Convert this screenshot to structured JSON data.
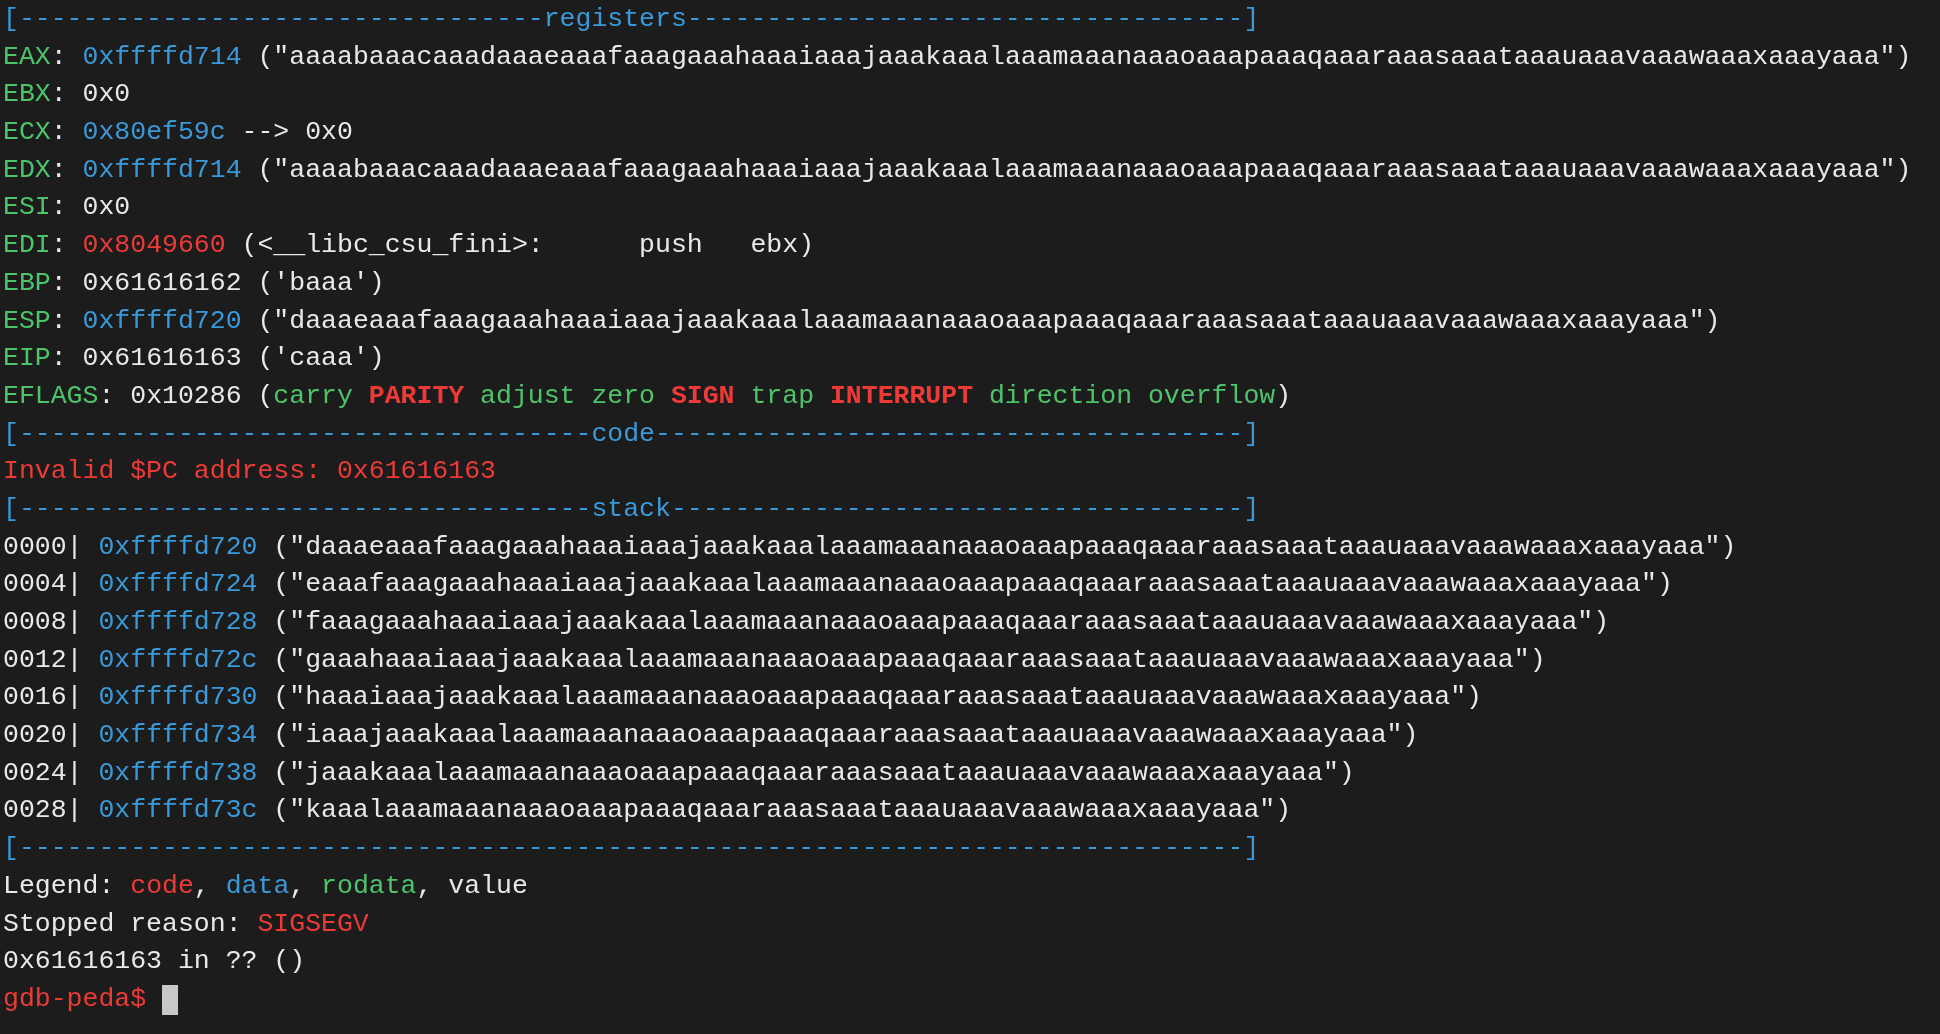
{
  "terminal": {
    "lines": [
      {
        "segments": [
          {
            "kind": "header",
            "text": "[---------------------------------registers-----------------------------------]"
          }
        ]
      },
      {
        "segments": [
          {
            "kind": "register",
            "text": "EAX"
          },
          {
            "kind": "value",
            "text": ": "
          },
          {
            "kind": "data",
            "text": "0xffffd714"
          },
          {
            "kind": "value",
            "text": " (\"aaaabaaacaaadaaaeaaafaaagaaahaaaiaaajaaakaaalaaamaaanaaaoaaapaaaqaaaraaasaaataaauaaavaaawaaaxaaayaaa\")"
          }
        ]
      },
      {
        "segments": [
          {
            "kind": "register",
            "text": "EBX"
          },
          {
            "kind": "value",
            "text": ": 0x0"
          }
        ]
      },
      {
        "segments": [
          {
            "kind": "register",
            "text": "ECX"
          },
          {
            "kind": "value",
            "text": ": "
          },
          {
            "kind": "data",
            "text": "0x80ef59c"
          },
          {
            "kind": "value",
            "text": " --> 0x0"
          }
        ]
      },
      {
        "segments": [
          {
            "kind": "register",
            "text": "EDX"
          },
          {
            "kind": "value",
            "text": ": "
          },
          {
            "kind": "data",
            "text": "0xffffd714"
          },
          {
            "kind": "value",
            "text": " (\"aaaabaaacaaadaaaeaaafaaagaaahaaaiaaajaaakaaalaaamaaanaaaoaaapaaaqaaaraaasaaataaauaaavaaawaaaxaaayaaa\")"
          }
        ]
      },
      {
        "segments": [
          {
            "kind": "register",
            "text": "ESI"
          },
          {
            "kind": "value",
            "text": ": 0x0"
          }
        ]
      },
      {
        "segments": [
          {
            "kind": "register",
            "text": "EDI"
          },
          {
            "kind": "value",
            "text": ": "
          },
          {
            "kind": "code",
            "text": "0x8049660"
          },
          {
            "kind": "value",
            "text": " (<__libc_csu_fini>:      push   ebx)"
          }
        ]
      },
      {
        "segments": [
          {
            "kind": "register",
            "text": "EBP"
          },
          {
            "kind": "value",
            "text": ": 0x61616162 ('baaa')"
          }
        ]
      },
      {
        "segments": [
          {
            "kind": "register",
            "text": "ESP"
          },
          {
            "kind": "value",
            "text": ": "
          },
          {
            "kind": "data",
            "text": "0xffffd720"
          },
          {
            "kind": "value",
            "text": " (\"daaaeaaafaaagaaahaaaiaaajaaakaaalaaamaaanaaaoaaapaaaqaaaraaasaaataaauaaavaaawaaaxaaayaaa\")"
          }
        ]
      },
      {
        "segments": [
          {
            "kind": "register",
            "text": "EIP"
          },
          {
            "kind": "value",
            "text": ": 0x61616163 ('caaa')"
          }
        ]
      },
      {
        "segments": [
          {
            "kind": "register",
            "text": "EFLAGS"
          },
          {
            "kind": "value",
            "text": ": 0x10286 ("
          },
          {
            "kind": "flag",
            "set": false,
            "text": "carry"
          },
          {
            "kind": "flag",
            "set": true,
            "text": "PARITY"
          },
          {
            "kind": "flag",
            "set": false,
            "text": "adjust"
          },
          {
            "kind": "flag",
            "set": false,
            "text": "zero"
          },
          {
            "kind": "flag",
            "set": true,
            "text": "SIGN"
          },
          {
            "kind": "flag",
            "set": false,
            "text": "trap"
          },
          {
            "kind": "flag",
            "set": true,
            "text": "INTERRUPT"
          },
          {
            "kind": "flag",
            "set": false,
            "text": "direction"
          },
          {
            "kind": "flag",
            "set": false,
            "text": "overflow"
          },
          {
            "kind": "value",
            "text": ")"
          }
        ]
      },
      {
        "segments": [
          {
            "kind": "header",
            "text": "[------------------------------------code-------------------------------------]"
          }
        ]
      },
      {
        "segments": [
          {
            "kind": "error",
            "text": "Invalid $PC address: 0x61616163"
          }
        ]
      },
      {
        "segments": [
          {
            "kind": "header",
            "text": "[------------------------------------stack------------------------------------]"
          }
        ]
      },
      {
        "segments": [
          {
            "kind": "value",
            "text": "0000| "
          },
          {
            "kind": "data",
            "text": "0xffffd720"
          },
          {
            "kind": "value",
            "text": " (\"daaaeaaafaaagaaahaaaiaaajaaakaaalaaamaaanaaaoaaapaaaqaaaraaasaaataaauaaavaaawaaaxaaayaaa\")"
          }
        ]
      },
      {
        "segments": [
          {
            "kind": "value",
            "text": "0004| "
          },
          {
            "kind": "data",
            "text": "0xffffd724"
          },
          {
            "kind": "value",
            "text": " (\"eaaafaaagaaahaaaiaaajaaakaaalaaamaaanaaaoaaapaaaqaaaraaasaaataaauaaavaaawaaaxaaayaaa\")"
          }
        ]
      },
      {
        "segments": [
          {
            "kind": "value",
            "text": "0008| "
          },
          {
            "kind": "data",
            "text": "0xffffd728"
          },
          {
            "kind": "value",
            "text": " (\"faaagaaahaaaiaaajaaakaaalaaamaaanaaaoaaapaaaqaaaraaasaaataaauaaavaaawaaaxaaayaaa\")"
          }
        ]
      },
      {
        "segments": [
          {
            "kind": "value",
            "text": "0012| "
          },
          {
            "kind": "data",
            "text": "0xffffd72c"
          },
          {
            "kind": "value",
            "text": " (\"gaaahaaaiaaajaaakaaalaaamaaanaaaoaaapaaaqaaaraaasaaataaauaaavaaawaaaxaaayaaa\")"
          }
        ]
      },
      {
        "segments": [
          {
            "kind": "value",
            "text": "0016| "
          },
          {
            "kind": "data",
            "text": "0xffffd730"
          },
          {
            "kind": "value",
            "text": " (\"haaaiaaajaaakaaalaaamaaanaaaoaaapaaaqaaaraaasaaataaauaaavaaawaaaxaaayaaa\")"
          }
        ]
      },
      {
        "segments": [
          {
            "kind": "value",
            "text": "0020| "
          },
          {
            "kind": "data",
            "text": "0xffffd734"
          },
          {
            "kind": "value",
            "text": " (\"iaaajaaakaaalaaamaaanaaaoaaapaaaqaaaraaasaaataaauaaavaaawaaaxaaayaaa\")"
          }
        ]
      },
      {
        "segments": [
          {
            "kind": "value",
            "text": "0024| "
          },
          {
            "kind": "data",
            "text": "0xffffd738"
          },
          {
            "kind": "value",
            "text": " (\"jaaakaaalaaamaaanaaaoaaapaaaqaaaraaasaaataaauaaavaaawaaaxaaayaaa\")"
          }
        ]
      },
      {
        "segments": [
          {
            "kind": "value",
            "text": "0028| "
          },
          {
            "kind": "data",
            "text": "0xffffd73c"
          },
          {
            "kind": "value",
            "text": " (\"kaaalaaamaaanaaaoaaapaaaqaaaraaasaaataaauaaavaaawaaaxaaayaaa\")"
          }
        ]
      },
      {
        "segments": [
          {
            "kind": "header",
            "text": "[-----------------------------------------------------------------------------]"
          }
        ]
      },
      {
        "segments": [
          {
            "kind": "value",
            "text": "Legend: "
          },
          {
            "kind": "code",
            "text": "code"
          },
          {
            "kind": "value",
            "text": ", "
          },
          {
            "kind": "data",
            "text": "data"
          },
          {
            "kind": "value",
            "text": ", "
          },
          {
            "kind": "rodata",
            "text": "rodata"
          },
          {
            "kind": "value",
            "text": ", value"
          }
        ]
      },
      {
        "segments": [
          {
            "kind": "value",
            "text": "Stopped reason: "
          },
          {
            "kind": "error",
            "text": "SIGSEGV"
          }
        ]
      },
      {
        "segments": [
          {
            "kind": "value",
            "text": "0x61616163 in ?? ()"
          }
        ]
      },
      {
        "segments": [
          {
            "kind": "prompt",
            "text": "gdb-peda$ "
          }
        ],
        "cursor": true
      }
    ]
  }
}
